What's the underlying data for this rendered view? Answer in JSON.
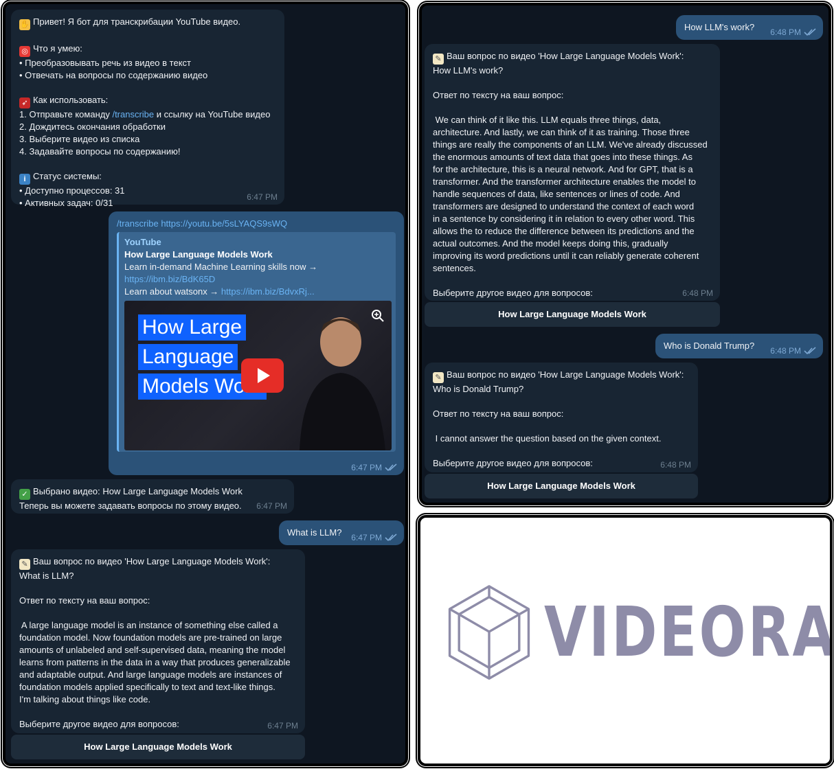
{
  "left": {
    "welcome": {
      "lines": [
        "Привет! Я бот для транскрибации YouTube видео.",
        "",
        "Что я умею:",
        "• Преобразовывать речь из видео в текст",
        "• Отвечать на вопросы по содержанию видео",
        "",
        "Как использовать:",
        "1. Отправьте команду ",
        "2. Дождитесь окончания обработки",
        "3. Выберите видео из списка",
        "4. Задавайте вопросы по содержанию!",
        "",
        "Статус системы:",
        "• Доступно процессов: 31",
        "• Активных задач: 0/31"
      ],
      "cmd": "/transcribe",
      "cmd_tail": " и ссылку на YouTube видео",
      "time": "6:47 PM"
    },
    "link_msg": {
      "command": "/transcribe",
      "url": "https://youtu.be/5sLYAQS9sWQ",
      "preview_site": "YouTube",
      "preview_title": "How Large Language Models Work",
      "preview_desc1": "Learn in-demand Machine Learning skills now →",
      "preview_link1": "https://ibm.biz/BdK65D",
      "preview_desc2": "Learn about watsonx → ",
      "preview_link2": "https://ibm.biz/BdvxRj...",
      "thumb_lines": [
        "How Large",
        "Language",
        "Models Work"
      ],
      "time": "6:47 PM"
    },
    "selected": {
      "line1": "Выбрано видео: How Large Language Models Work",
      "line2": "Теперь вы можете задавать вопросы по этому видео.",
      "time": "6:47 PM"
    },
    "question": {
      "text": "What is LLM?",
      "time": "6:47 PM"
    },
    "answer": {
      "lines": [
        "Ваш вопрос по видео 'How Large Language Models Work':",
        "What is LLM?",
        "",
        "Ответ по тексту на ваш вопрос:",
        "",
        " A large language model is an instance of something else called a",
        "foundation model. Now foundation models are pre-trained on large",
        "amounts of unlabeled and self-supervised data, meaning the model",
        "learns from patterns in the data in a way that produces generalizable",
        "and adaptable output. And large language models are instances of",
        "foundation models applied specifically to text and text-like things.",
        "I'm talking about things like code.",
        "",
        "Выберите другое видео для вопросов:"
      ],
      "time": "6:47 PM",
      "button": "How Large Language Models Work"
    }
  },
  "right": {
    "q1": {
      "text": "How LLM's work?",
      "time": "6:48 PM"
    },
    "a1": {
      "lines": [
        "Ваш вопрос по видео 'How Large Language Models Work':",
        "How LLM's work?",
        "",
        "Ответ по тексту на ваш вопрос:",
        "",
        " We can think of it like this. LLM equals three things, data,",
        "architecture. And lastly, we can think of it as training. Those three",
        "things are really the components of an LLM. We've already discussed",
        "the enormous amounts of text data that goes into these things. As",
        "for the architecture, this is a neural network. And for GPT, that is a",
        "transformer. And the transformer architecture enables the model to",
        "handle sequences of data, like sentences or lines of code. And",
        "transformers are designed to understand the context of each word",
        "in a sentence by considering it in relation to every other word. This",
        "allows the to reduce the difference between its predictions and the",
        "actual outcomes. And the model keeps doing this, gradually",
        "improving its word predictions until it can reliably generate coherent",
        "sentences.",
        "",
        "Выберите другое видео для вопросов:"
      ],
      "time": "6:48 PM",
      "button": "How Large Language Models Work"
    },
    "q2": {
      "text": "Who is Donald Trump?",
      "time": "6:48 PM"
    },
    "a2": {
      "lines": [
        "Ваш вопрос по видео 'How Large Language Models Work':",
        "Who is Donald Trump?",
        "",
        "Ответ по тексту на ваш вопрос:",
        "",
        " I cannot answer the question based on the given context.",
        "",
        "Выберите другое видео для вопросов:"
      ],
      "time": "6:48 PM",
      "button": "How Large Language Models Work"
    }
  },
  "logo": {
    "text": "VIDEORAG",
    "color": "#8e8ca8"
  },
  "colors": {
    "chat_bg": "#0e1621",
    "incoming": "#182533",
    "outgoing": "#2b5278",
    "link": "#6ab3f3",
    "keyboard_button": "#1e2c3a"
  },
  "icons": [
    "wave-emoji",
    "target-emoji",
    "rocket-emoji",
    "info-emoji",
    "check-emoji",
    "memo-emoji",
    "double-check-icon",
    "zoom-icon",
    "play-icon",
    "cube-logo-icon"
  ]
}
